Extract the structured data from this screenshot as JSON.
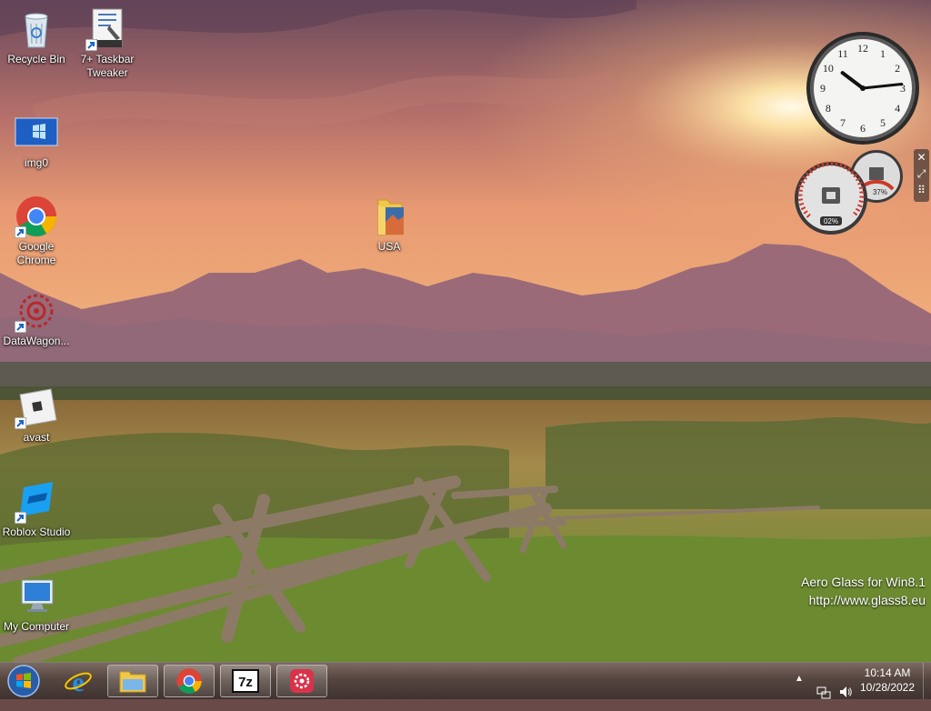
{
  "desktop_icons": [
    {
      "label": "Recycle Bin",
      "icon": "recycle-bin-icon"
    },
    {
      "label": "7+ Taskbar Tweaker",
      "icon": "taskbar-tweaker-icon"
    },
    {
      "label": "img0",
      "icon": "image-icon"
    },
    {
      "label": "Google Chrome",
      "icon": "chrome-icon"
    },
    {
      "label": "DataWagon...",
      "icon": "datawagon-icon"
    },
    {
      "label": "avast",
      "icon": "avast-icon"
    },
    {
      "label": "Roblox Studio",
      "icon": "roblox-studio-icon"
    },
    {
      "label": "My Computer",
      "icon": "computer-icon"
    },
    {
      "label": "USA",
      "icon": "folder-icon"
    }
  ],
  "watermark": {
    "line1": "Aero Glass for Win8.1",
    "line2": "http://www.glass8.eu"
  },
  "gadgets": {
    "clock": {
      "hour": 10,
      "minute": 14
    },
    "cpu_meter": {
      "cpu": "02%",
      "memory": "37%",
      "cpu_value": 2,
      "memory_value": 37
    }
  },
  "taskbar": {
    "items": [
      {
        "name": "internet-explorer-icon",
        "open": false
      },
      {
        "name": "file-explorer-icon",
        "open": true
      },
      {
        "name": "chrome-icon",
        "open": true
      },
      {
        "name": "7zip-icon",
        "open": true,
        "label": "7z"
      },
      {
        "name": "app-icon",
        "open": true
      }
    ],
    "time": "10:14 AM",
    "date": "10/28/2022"
  },
  "colors": {
    "taskbar": "#54453f",
    "sky_top": "#6a4a5c",
    "sun": "#fff2c0"
  }
}
